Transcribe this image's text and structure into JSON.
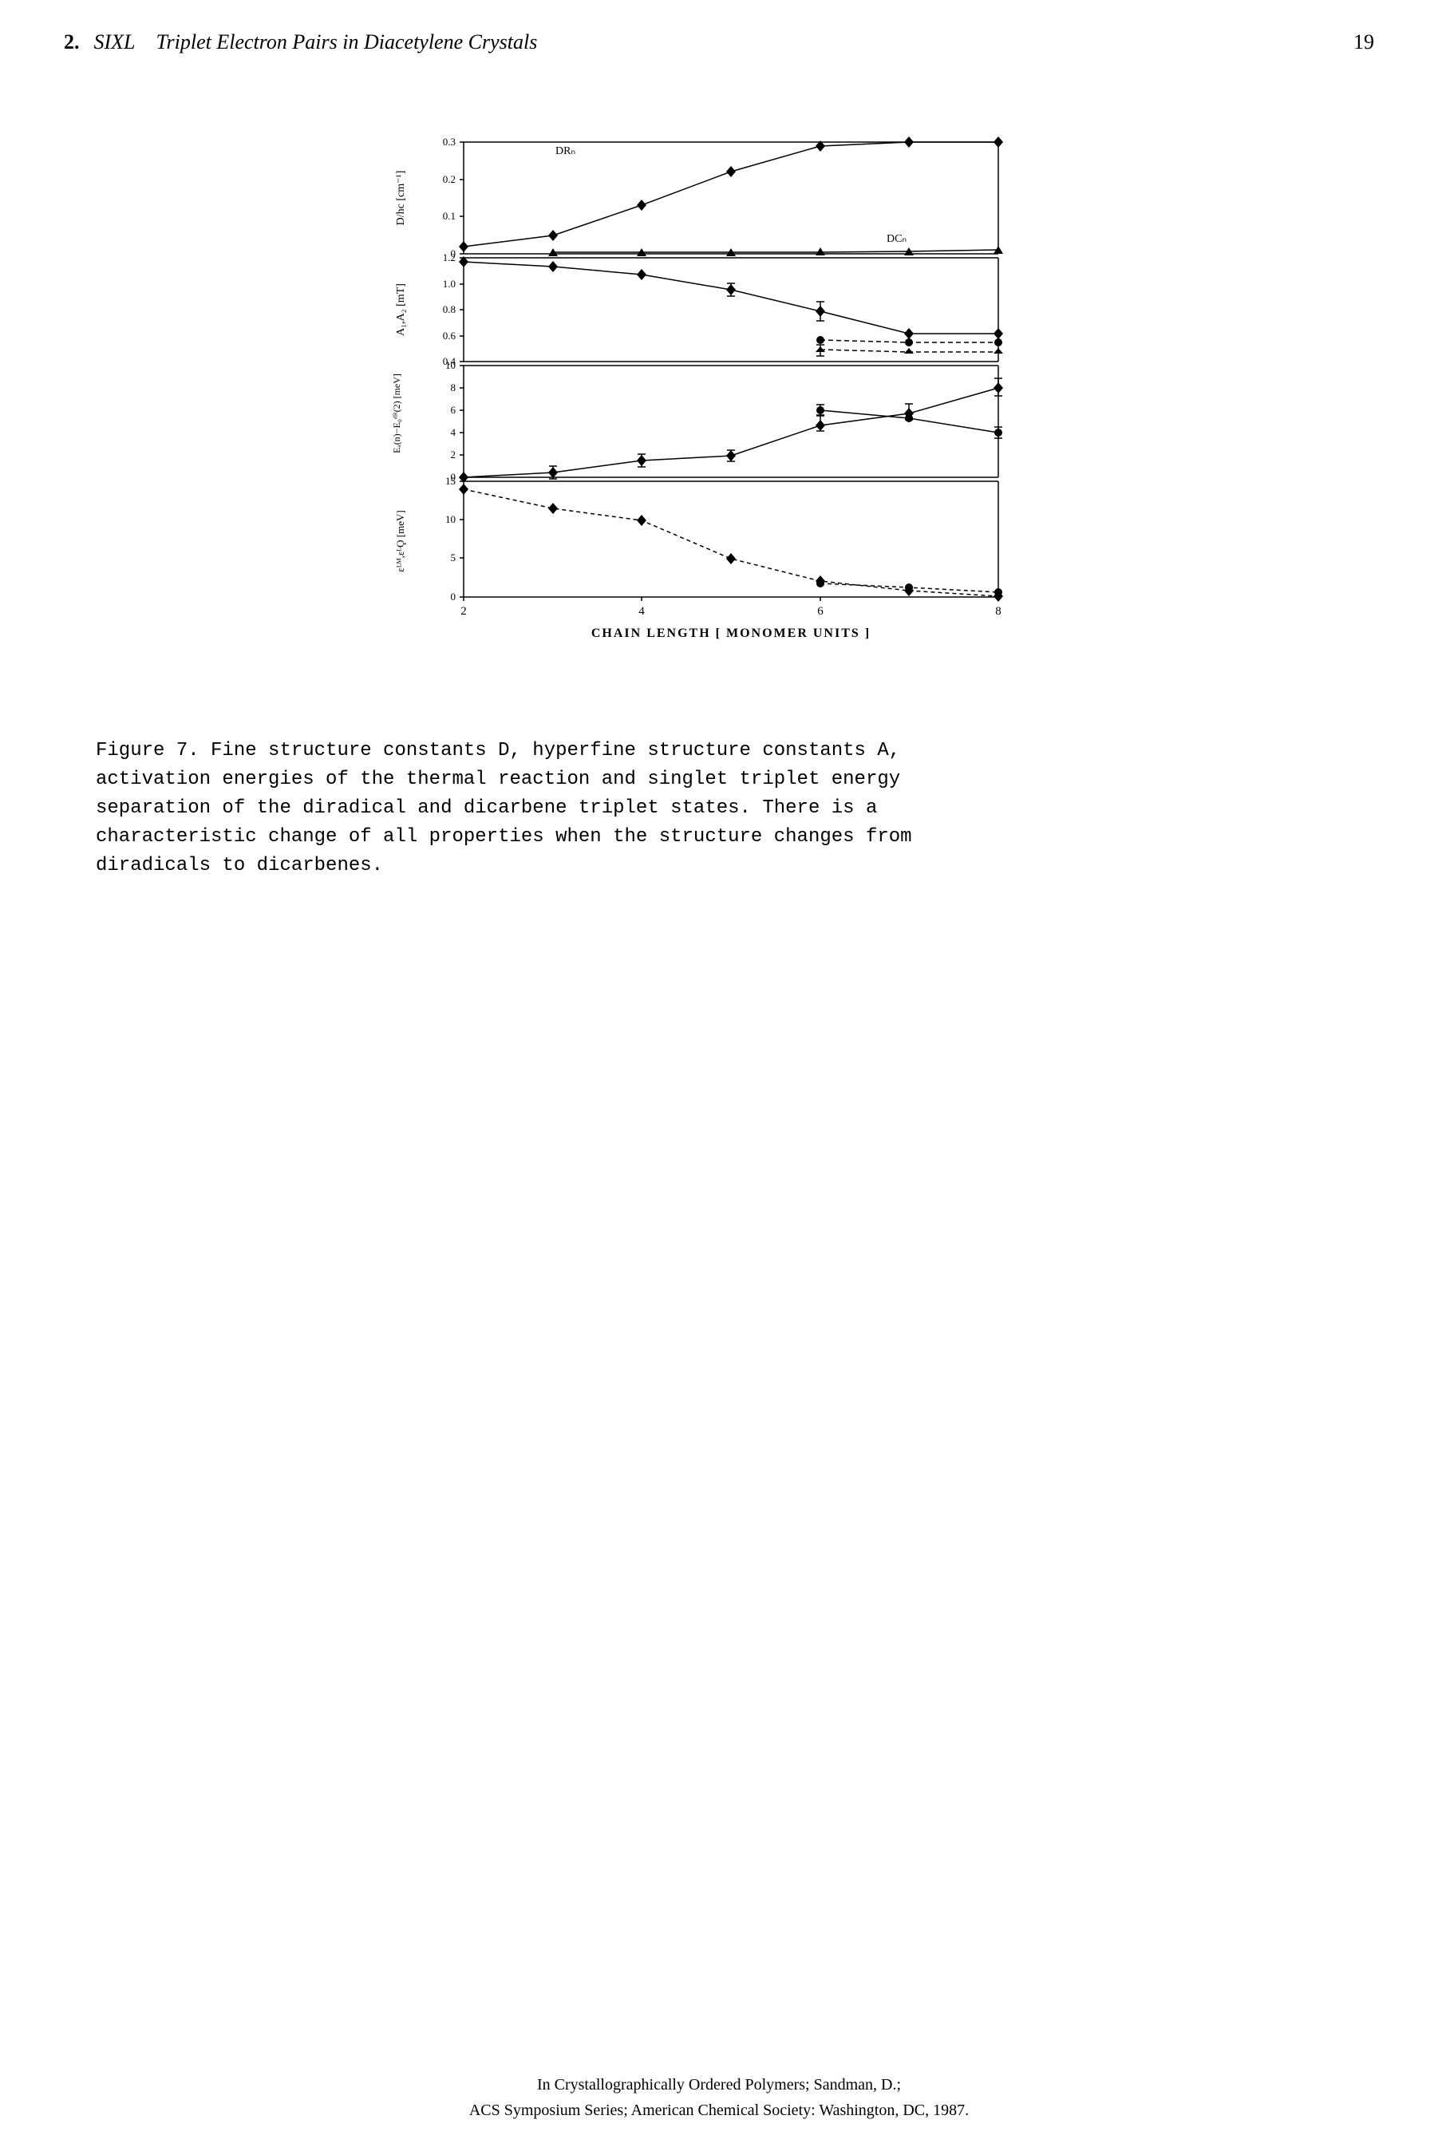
{
  "header": {
    "chapter": "2.",
    "author": "SIXL",
    "title": "Triplet Electron Pairs in Diacetylene Crystals",
    "page": "19"
  },
  "chart": {
    "title": "Figure 7",
    "x_label": "CHAIN LENGTH [ MONOMER UNITS ]",
    "x_ticks": [
      "2",
      "4",
      "6",
      "8"
    ],
    "panels": [
      {
        "y_label": "D/hc [cm⁻¹]",
        "y_ticks": [
          "0",
          "0.1",
          "0.2",
          "0.3"
        ],
        "series_DR": {
          "label": "DRₙ",
          "style": "solid"
        },
        "series_DC": {
          "label": "DCₙ",
          "style": "solid"
        }
      },
      {
        "y_label": "A₁,A₂ [mT]",
        "y_ticks": [
          "0.4",
          "0.6",
          "0.8",
          "1.0",
          "1.2"
        ]
      },
      {
        "y_label": "Eₐ(n)−E₀ᴰᴿ(2) [meV]",
        "y_ticks": [
          "0",
          "2",
          "4",
          "6",
          "8",
          "10"
        ]
      },
      {
        "y_label": "ε_ST, ε_SQ [meV]",
        "y_ticks": [
          "0",
          "5",
          "10",
          "15"
        ]
      }
    ]
  },
  "caption": {
    "text": "Figure 7.  Fine structure constants D, hyperfine structure constants A, activation energies of the thermal reaction and singlet triplet energy separation of the diradical and dicarbene triplet states.  There is a characteristic change of all properties when the structure changes from diradicals to dicarbenes."
  },
  "footer": {
    "line1": "In Crystallographically Ordered Polymers; Sandman, D.;",
    "line2": "ACS Symposium Series; American Chemical Society: Washington, DC, 1987."
  }
}
